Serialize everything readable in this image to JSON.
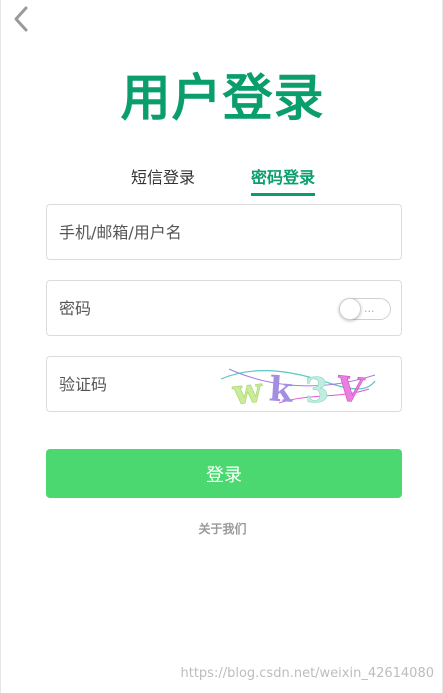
{
  "header": {
    "back_icon": "chevron-left-icon"
  },
  "title": "用户登录",
  "tabs": [
    {
      "label": "短信登录",
      "active": false
    },
    {
      "label": "密码登录",
      "active": true
    }
  ],
  "form": {
    "username_placeholder": "手机/邮箱/用户名",
    "password_placeholder": "密码",
    "password_toggle_text": "...",
    "captcha_placeholder": "验证码",
    "captcha_text": "wk3V"
  },
  "login_button": "登录",
  "about_link": "关于我们",
  "watermark": "https://blog.csdn.net/weixin_42614080",
  "colors": {
    "accent": "#0a9e6c",
    "button": "#4cd870",
    "border": "#dcdcdc"
  }
}
